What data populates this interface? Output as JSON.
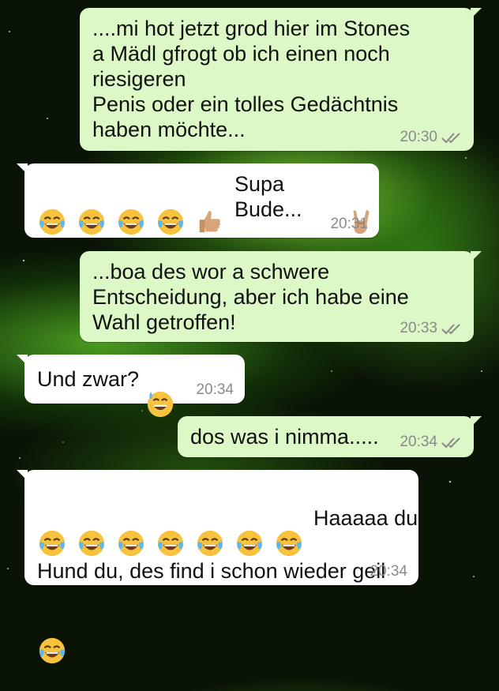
{
  "chat": {
    "messages": [
      {
        "direction": "outgoing",
        "text": "....mi hot jetzt grod hier im Stones\na Mädl gfrogt ob ich einen noch\nriesigeren\nPenis oder ein tolles Gedächtnis\nhaben möchte...",
        "time": "20:30",
        "status": "read"
      },
      {
        "direction": "incoming",
        "emoji_prefix": [
          "face-with-tears-of-joy",
          "face-with-tears-of-joy",
          "face-with-tears-of-joy",
          "face-with-tears-of-joy",
          "thumbs-up"
        ],
        "text": "Supa Bude...",
        "emoji_suffix": [
          "sign-of-the-horns"
        ],
        "time": "20:31"
      },
      {
        "direction": "outgoing",
        "text": "...boa des wor a schwere\nEntscheidung, aber ich habe eine\nWahl getroffen!",
        "time": "20:33",
        "status": "read"
      },
      {
        "direction": "incoming",
        "text": "Und zwar?",
        "emoji_suffix": [
          "grinning-face-with-sweat"
        ],
        "time": "20:34"
      },
      {
        "direction": "outgoing",
        "text": "dos was i nimma.....",
        "time": "20:34",
        "status": "read"
      },
      {
        "direction": "incoming",
        "emoji_prefix": [
          "face-with-tears-of-joy",
          "face-with-tears-of-joy",
          "face-with-tears-of-joy",
          "face-with-tears-of-joy",
          "face-with-tears-of-joy",
          "face-with-tears-of-joy",
          "face-with-tears-of-joy"
        ],
        "text": "Haaaaa du",
        "text_line2": "Hund du, des find i schon wieder geil",
        "emoji_line3": [
          "face-with-tears-of-joy"
        ],
        "time": "20:34"
      }
    ]
  },
  "colors": {
    "outgoing_bubble": "#dcf8c6",
    "incoming_bubble": "#ffffff",
    "read_ticks": "#8a8a8a",
    "wallpaper": "green nebula"
  }
}
